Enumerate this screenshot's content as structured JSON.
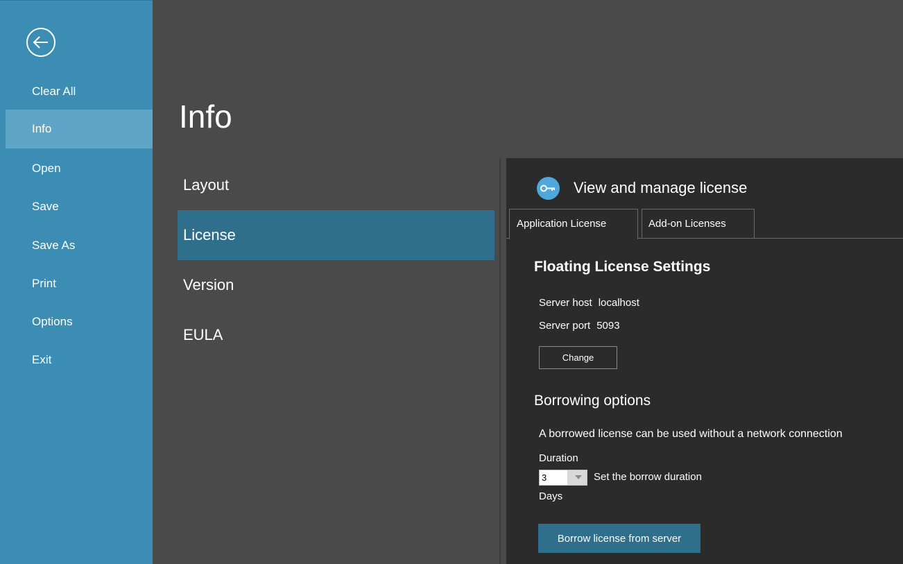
{
  "rail": {
    "back_icon": "arrow-left-circle-icon",
    "items": [
      {
        "label": "Clear All"
      },
      {
        "label": "Info",
        "active": true
      },
      {
        "label": "Open"
      },
      {
        "label": "Save"
      },
      {
        "label": "Save As"
      },
      {
        "label": "Print"
      },
      {
        "label": "Options"
      },
      {
        "label": "Exit"
      }
    ]
  },
  "page": {
    "title": "Info",
    "subnav": [
      {
        "label": "Layout"
      },
      {
        "label": "License",
        "active": true
      },
      {
        "label": "Version"
      },
      {
        "label": "EULA"
      }
    ]
  },
  "license_panel": {
    "icon": "key-icon",
    "title": "View and manage license",
    "tabs": [
      {
        "label": "Application License",
        "active": true
      },
      {
        "label": "Add-on Licenses"
      }
    ],
    "floating": {
      "title": "Floating License Settings",
      "server_host_label": "Server host",
      "server_host_value": "localhost",
      "server_port_label": "Server port",
      "server_port_value": "5093",
      "change_label": "Change"
    },
    "borrowing": {
      "title": "Borrowing options",
      "description": "A borrowed license can be used without a network connection",
      "duration_label": "Duration",
      "duration_value": "3",
      "duration_help": "Set the borrow duration",
      "unit_label": "Days",
      "borrow_button": "Borrow license from server"
    }
  },
  "colors": {
    "rail_bg": "#3b8db4",
    "rail_active": "#5fa5c7",
    "content_bg": "#4a4a4a",
    "panel_bg": "#2b2b2b",
    "accent": "#2f6f8b"
  }
}
